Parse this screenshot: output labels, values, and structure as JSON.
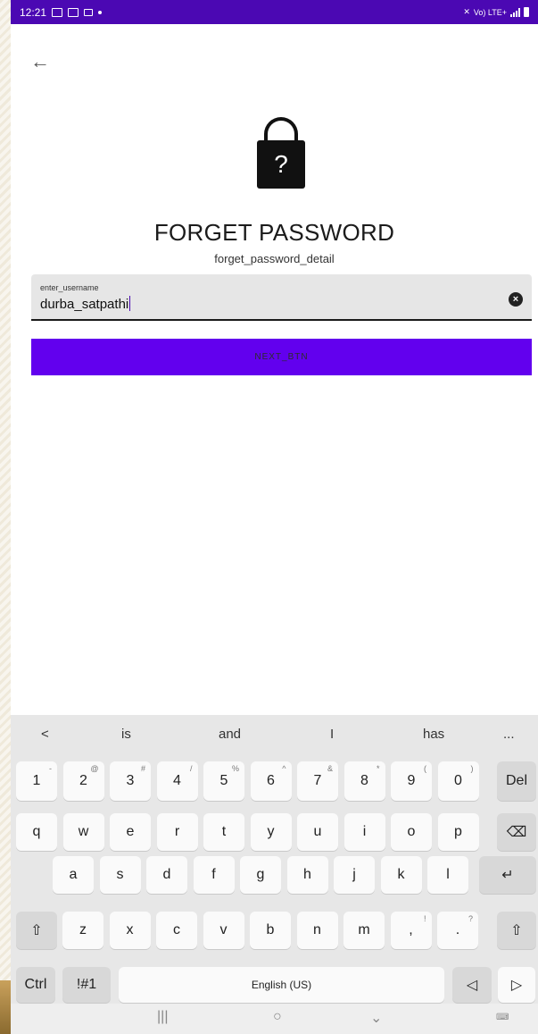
{
  "status_bar": {
    "time": "12:21",
    "right_text": "Vo) LTE+"
  },
  "screen": {
    "lock_symbol": "?",
    "title": "FORGET PASSWORD",
    "subtitle": "forget_password_detail",
    "field": {
      "label": "enter_username",
      "value": "durba_satpathi"
    },
    "next_button": "NEXT_BTN"
  },
  "keyboard": {
    "suggestions": [
      "<",
      "is",
      "and",
      "I",
      "has",
      "..."
    ],
    "number_row": [
      {
        "k": "1",
        "s": "-"
      },
      {
        "k": "2",
        "s": "@"
      },
      {
        "k": "3",
        "s": "#"
      },
      {
        "k": "4",
        "s": "/"
      },
      {
        "k": "5",
        "s": "%"
      },
      {
        "k": "6",
        "s": "^"
      },
      {
        "k": "7",
        "s": "&"
      },
      {
        "k": "8",
        "s": "*"
      },
      {
        "k": "9",
        "s": "("
      },
      {
        "k": "0",
        "s": ")"
      }
    ],
    "del": "Del",
    "row_q": [
      "q",
      "w",
      "e",
      "r",
      "t",
      "y",
      "u",
      "i",
      "o",
      "p"
    ],
    "row_a": [
      "a",
      "s",
      "d",
      "f",
      "g",
      "h",
      "j",
      "k",
      "l"
    ],
    "row_z": [
      "z",
      "x",
      "c",
      "v",
      "b",
      "n",
      "m",
      ",",
      "."
    ],
    "row_z_sub": [
      "",
      "",
      "",
      "",
      "",
      "",
      "",
      "!",
      "?"
    ],
    "ctrl": "Ctrl",
    "symbols": "!#1",
    "space": "English (US)"
  }
}
